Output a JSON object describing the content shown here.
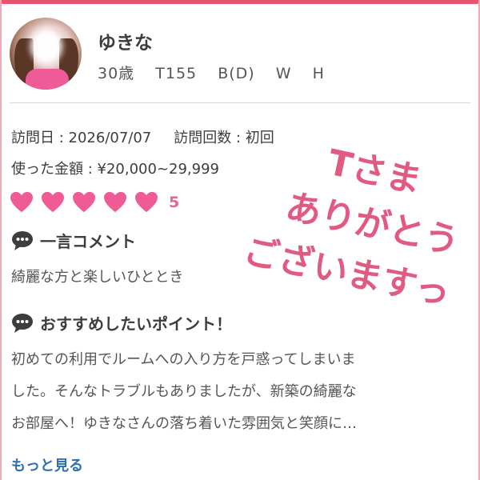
{
  "profile": {
    "name": "ゆきな",
    "specs": "30歳  T155  B(D)  W  H"
  },
  "visit": {
    "date_label": "訪問日 : 2026/07/07",
    "count_label": "訪問回数 : 初回",
    "price_label": "使った金額 : ¥20,000~29,999"
  },
  "rating": {
    "value": "5",
    "hearts": 5,
    "heart_color": "#ef5c95"
  },
  "comment": {
    "heading": "一言コメント",
    "text": "綺麗な方と楽しいひととき"
  },
  "points": {
    "heading": "おすすめしたいポイント！",
    "lines": [
      "初めての利用でルームへの入り方を戸惑ってしまいま",
      "した。そんなトラブルもありましたが、新築の綺麗な",
      "お部屋へ！ゆきなさんの落ち着いた雰囲気と笑顔に…"
    ]
  },
  "more_link": "もっと見る",
  "stamp": {
    "line1": "Tさま",
    "line2": "ありがとう",
    "line3": "ございますっ",
    "fill": "#e05a82",
    "stroke": "#ffffff"
  },
  "colors": {
    "accent": "#e8546f",
    "link": "#2f6fb0"
  }
}
